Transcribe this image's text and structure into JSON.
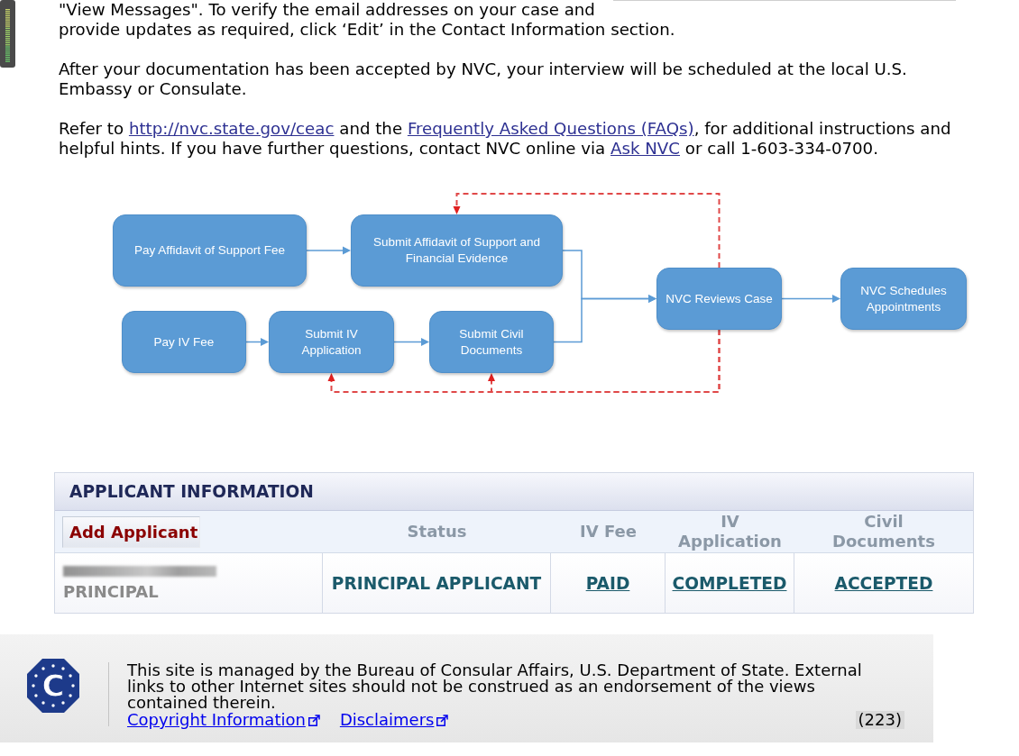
{
  "paragraphs": [
    {
      "parts": [
        {
          "kind": "text",
          "text": "\"View Messages\". To verify the email addresses on your case and provide updates as required, click ‘Edit’ in the Contact Information section."
        }
      ]
    },
    {
      "parts": [
        {
          "kind": "text",
          "text": "After your documentation has been accepted by NVC, your interview will be scheduled at the local U.S. Embassy or Consulate."
        }
      ]
    },
    {
      "parts": [
        {
          "kind": "text",
          "text": "Refer to "
        },
        {
          "kind": "link",
          "text": "http://nvc.state.gov/ceac"
        },
        {
          "kind": "text",
          "text": " and the "
        },
        {
          "kind": "link",
          "text": "Frequently Asked Questions (FAQs)"
        },
        {
          "kind": "text",
          "text": ", for additional instructions and helpful hints. If you have further questions, contact NVC online via "
        },
        {
          "kind": "link",
          "text": "Ask NVC"
        },
        {
          "kind": "text",
          "text": " or call 1-603-334-0700."
        }
      ]
    }
  ],
  "process_diagram": {
    "nodes": [
      {
        "label": "Pay Affidavit of Support Fee"
      },
      {
        "label": "Submit Affidavit of Support and Financial Evidence"
      },
      {
        "label": "Pay IV Fee"
      },
      {
        "label": "Submit IV Application"
      },
      {
        "label": "Submit Civil Documents"
      },
      {
        "label": "NVC Reviews Case"
      },
      {
        "label": "NVC Schedules Appointments"
      }
    ]
  },
  "applicant_information": {
    "title": "APPLICANT INFORMATION",
    "add_button": "Add Applicant",
    "columns": [
      "Status",
      "IV Fee",
      "IV Application",
      "Civil Documents"
    ],
    "rows": [
      {
        "role": "PRINCIPAL",
        "status": "PRINCIPAL APPLICANT",
        "iv_fee": "PAID",
        "iv_application": "COMPLETED",
        "civil_documents": "ACCEPTED"
      }
    ]
  },
  "footer": {
    "logo_letter": "C",
    "notice": "This site is managed by the Bureau of Consular Affairs, U.S. Department of State. External links to other Internet sites should not be construed as an endorsement of the views contained therein.",
    "links": [
      "Copyright Information",
      "Disclaimers"
    ],
    "count": "(223)"
  }
}
